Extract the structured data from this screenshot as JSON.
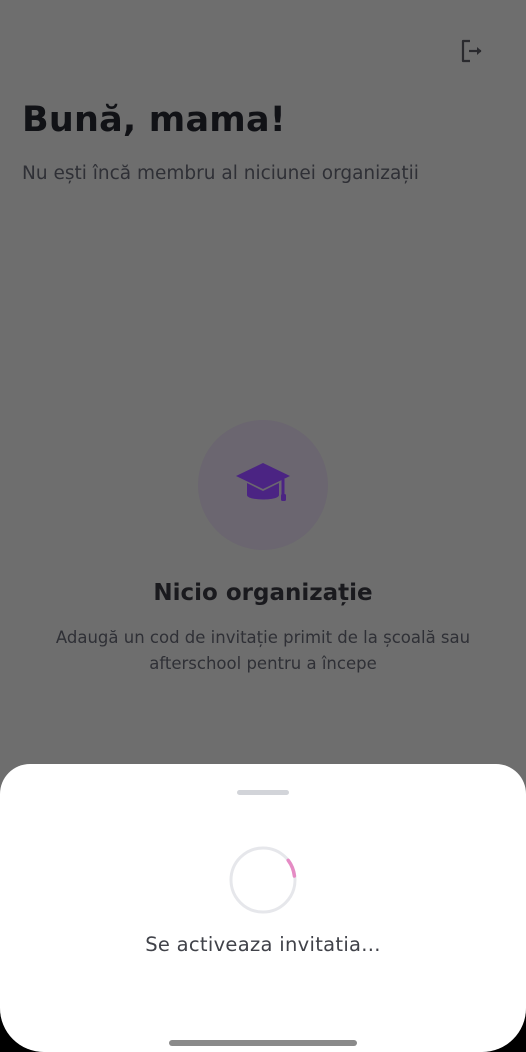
{
  "header": {
    "greeting": "Bună, mama!",
    "subtitle": "Nu ești încă membru al niciunei organizații",
    "logout_icon": "logout-icon"
  },
  "empty_state": {
    "icon": "graduation-cap-icon",
    "title": "Nicio organizație",
    "description": "Adaugă un cod de invitație primit de la școală sau afterschool pentru a începe"
  },
  "sheet": {
    "message": "Se activeaza invitatia...",
    "spinner_icon": "loading-spinner-icon"
  },
  "colors": {
    "accent": "#5b2c8f",
    "spinner_arc": "#e58bc4",
    "spinner_track": "#e6e7eb"
  }
}
